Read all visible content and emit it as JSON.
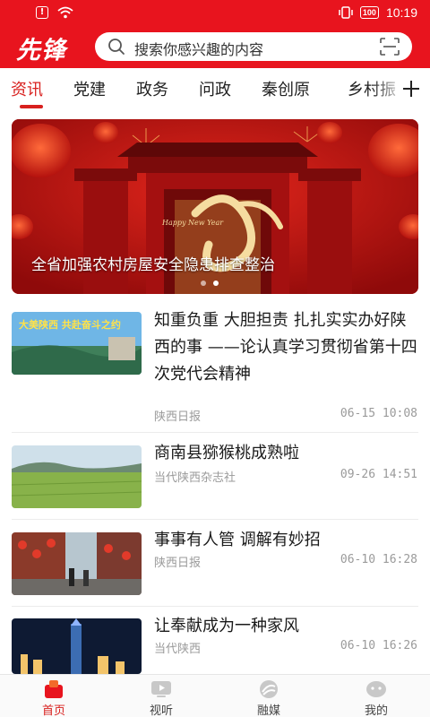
{
  "status_bar": {
    "time": "10:19",
    "battery": "100"
  },
  "header": {
    "logo": "先锋",
    "search_placeholder": "搜索你感兴趣的内容"
  },
  "tabs": [
    {
      "label": "资讯",
      "active": true
    },
    {
      "label": "党建"
    },
    {
      "label": "政务"
    },
    {
      "label": "问政"
    },
    {
      "label": "秦创原"
    },
    {
      "label": "乡村振"
    }
  ],
  "banner": {
    "caption": "全省加强农村房屋安全隐患排查整治",
    "decor_text": "Happy New Year",
    "active_dot": 1,
    "dot_count": 2
  },
  "news": [
    {
      "title": "知重负重 大胆担责 扎扎实实办好陕西的事 ——论认真学习贯彻省第十四次党代会精神",
      "source": "陕西日报",
      "time": "06-15 10:08",
      "thumb_text": "大美陕西 共赴奋斗之约"
    },
    {
      "title": "商南县猕猴桃成熟啦",
      "source": "当代陕西杂志社",
      "time": "09-26 14:51"
    },
    {
      "title": "事事有人管 调解有妙招",
      "source": "陕西日报",
      "time": "06-10 16:28"
    },
    {
      "title": "让奉献成为一种家风",
      "source": "当代陕西",
      "time": "06-10 16:26"
    }
  ],
  "bottom_nav": [
    {
      "label": "首页",
      "active": true
    },
    {
      "label": "视听"
    },
    {
      "label": "融媒"
    },
    {
      "label": "我的"
    }
  ],
  "colors": {
    "brand_red": "#e8141e",
    "active_red": "#d8201e"
  }
}
